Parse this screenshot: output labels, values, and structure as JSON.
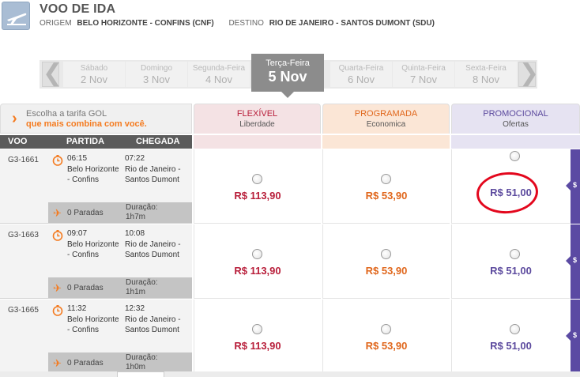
{
  "header": {
    "title": "VOO DE IDA",
    "origin_label": "ORIGEM",
    "origin_value": "BELO HORIZONTE - CONFINS (CNF)",
    "dest_label": "DESTINO",
    "dest_value": "RIO DE JANEIRO - SANTOS DUMONT (SDU)"
  },
  "dates": [
    {
      "weekday": "Sábado",
      "date": "2 Nov"
    },
    {
      "weekday": "Domingo",
      "date": "3 Nov"
    },
    {
      "weekday": "Segunda-Feira",
      "date": "4 Nov"
    },
    {
      "weekday": "Terça-Feira",
      "date": "5 Nov",
      "selected": true
    },
    {
      "weekday": "Quarta-Feira",
      "date": "6 Nov"
    },
    {
      "weekday": "Quinta-Feira",
      "date": "7 Nov"
    },
    {
      "weekday": "Sexta-Feira",
      "date": "8 Nov"
    }
  ],
  "nav": {
    "prev": "❮",
    "next": "❯"
  },
  "fare_intro": {
    "line1": "Escolha a tarifa GOL",
    "line2": "que mais combina com você."
  },
  "fare_tabs": [
    {
      "name": "FLEXÍVEL",
      "sub": "Liberdade",
      "color": "#b81e3a"
    },
    {
      "name": "PROGRAMADA",
      "sub": "Economica",
      "color": "#e0661b"
    },
    {
      "name": "PROMOCIONAL",
      "sub": "Ofertas",
      "color": "#5c4a9e"
    }
  ],
  "columns": {
    "flight": "VOO",
    "departure": "PARTIDA",
    "arrival": "CHEGADA"
  },
  "flights": [
    {
      "code": "G3-1661",
      "dep_time": "06:15",
      "dep_city": "Belo Horizonte - Confins",
      "arr_time": "07:22",
      "arr_city": "Rio de Janeiro - Santos Dumont",
      "stops": "0 Paradas",
      "duration_label": "Duração:",
      "duration": "1h7m",
      "prices": [
        "R$ 113,90",
        "R$ 53,90",
        "R$ 51,00"
      ]
    },
    {
      "code": "G3-1663",
      "dep_time": "09:07",
      "dep_city": "Belo Horizonte - Confins",
      "arr_time": "10:08",
      "arr_city": "Rio de Janeiro - Santos Dumont",
      "stops": "0 Paradas",
      "duration_label": "Duração:",
      "duration": "1h1m",
      "prices": [
        "R$ 113,90",
        "R$ 53,90",
        "R$ 51,00"
      ]
    },
    {
      "code": "G3-1665",
      "dep_time": "11:32",
      "dep_city": "Belo Horizonte - Confins",
      "arr_time": "12:32",
      "arr_city": "Rio de Janeiro - Santos Dumont",
      "stops": "0 Paradas",
      "duration_label": "Duração:",
      "duration": "1h0m",
      "prices": [
        "R$ 113,90",
        "R$ 53,90",
        "R$ 51,00"
      ]
    }
  ],
  "side_label": "$",
  "icons": {
    "header": "plane-departure-icon",
    "clock": "clock-icon",
    "stops": "plane-icon"
  }
}
